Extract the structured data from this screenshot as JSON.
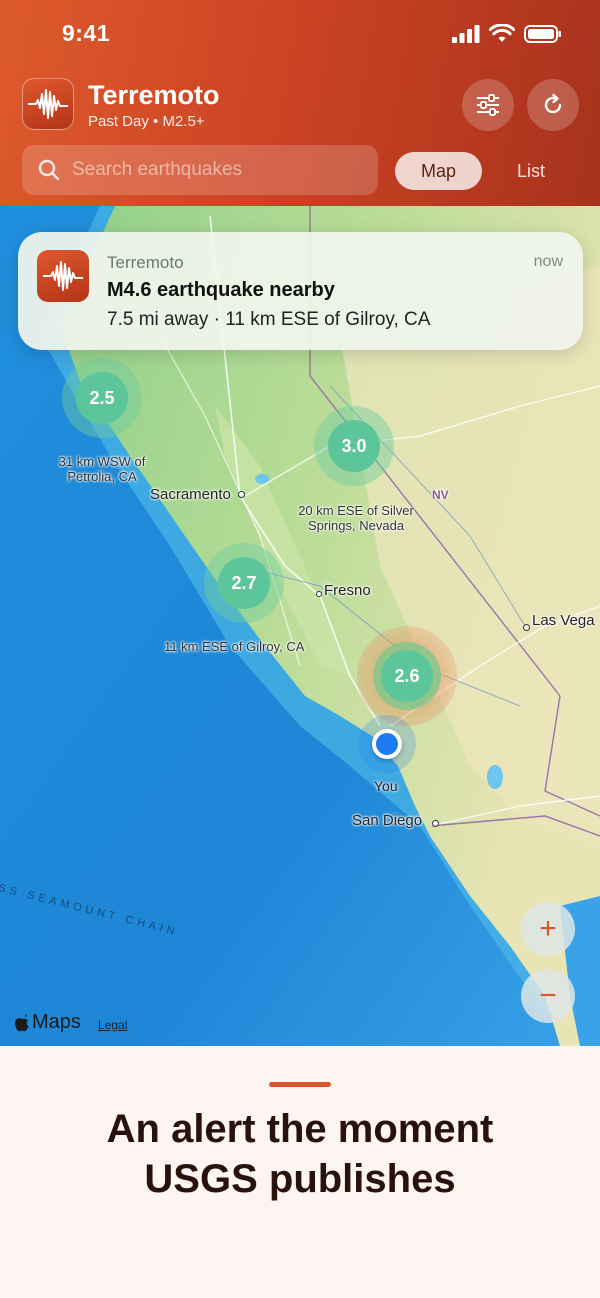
{
  "status_bar": {
    "time": "9:41"
  },
  "header": {
    "app_name": "Terremoto",
    "subtitle": "Past Day • M2.5+",
    "icons": {
      "filter": "sliders-icon",
      "refresh": "refresh-icon",
      "search": "search-icon"
    }
  },
  "search": {
    "placeholder": "Search earthquakes",
    "value": ""
  },
  "view_toggle": {
    "map_label": "Map",
    "list_label": "List",
    "selected": "Map"
  },
  "notification": {
    "app": "Terremoto",
    "time": "now",
    "title": "M4.6 earthquake nearby",
    "body": "7.5 mi away · 11 km ESE of Gilroy, CA"
  },
  "map": {
    "clusters": [
      {
        "magnitude": "2.5",
        "label": "31 km WSW of Petrolia, CA"
      },
      {
        "magnitude": "3.0",
        "label": "20 km ESE of Silver Springs, Nevada"
      },
      {
        "magnitude": "2.7",
        "label": "11 km ESE of Gilroy, CA"
      },
      {
        "magnitude": "2.6",
        "label": ""
      }
    ],
    "places": {
      "sacramento": "Sacramento",
      "fresno": "Fresno",
      "las_vegas": "Las Vega",
      "san_diego": "San Diego",
      "nv": "NV",
      "sea_label": "SS SEAMOUNT CHAIN"
    },
    "cluster_label_lines": {
      "petrolia_1": "31 km WSW of",
      "petrolia_2": "Petrolia, CA",
      "silver_1": "20 km ESE of Silver",
      "silver_2": "Springs, Nevada",
      "gilroy": "11 km ESE of Gilroy, CA"
    },
    "you_label": "You",
    "zoom_in": "+",
    "zoom_out": "−",
    "attribution": "Maps",
    "legal": "Legal"
  },
  "caption": {
    "line1": "An alert the moment",
    "line2": "USGS publishes"
  },
  "colors": {
    "accent": "#d9562b",
    "header": "#cc4424",
    "cluster": "#5cc59a",
    "user_dot": "#1e7cf2"
  }
}
